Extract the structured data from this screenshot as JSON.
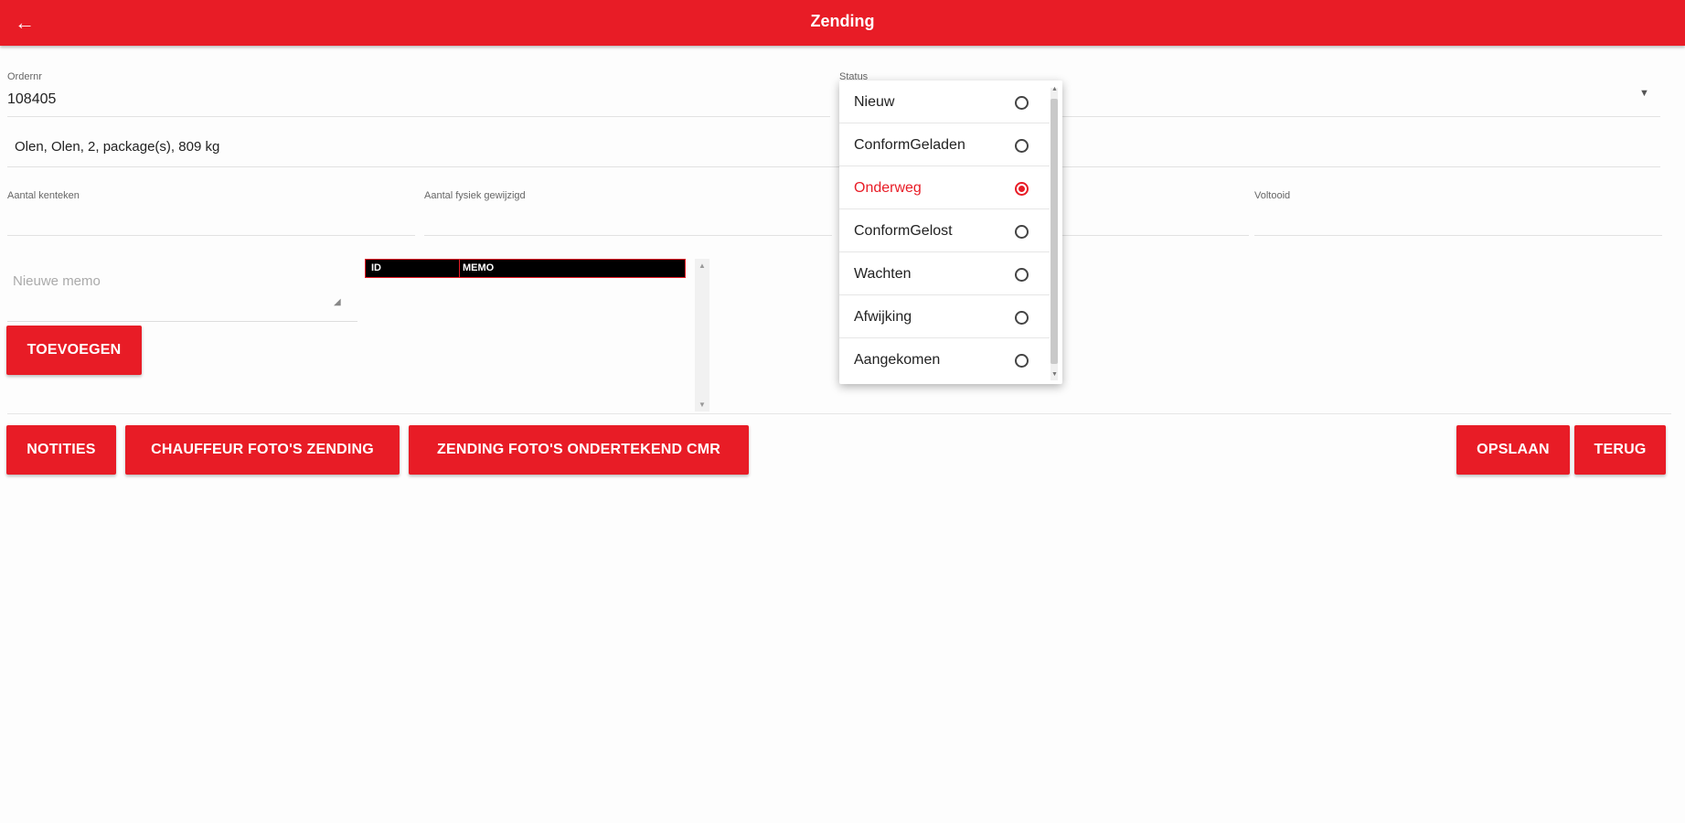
{
  "appbar": {
    "title": "Zending",
    "back_icon": "←"
  },
  "fields": {
    "ordernr": {
      "label": "Ordernr",
      "value": "108405"
    },
    "summary": {
      "value": "Olen, Olen, 2, package(s), 809 kg"
    },
    "status": {
      "label": "Status"
    },
    "aantal": {
      "label": "Aantal kenteken"
    },
    "aantal_gewijzigd": {
      "label": "Aantal fysiek gewijzigd"
    },
    "voltooid": {
      "label": "Voltooid"
    }
  },
  "memo": {
    "placeholder": "Nieuwe memo",
    "resize_icon": "◢"
  },
  "memo_table": {
    "col_id": "ID",
    "col_memo": "MEMO"
  },
  "buttons": {
    "toevoegen": "TOEVOEGEN",
    "notities": "NOTITIES",
    "chauffeur": "CHAUFFEUR FOTO'S ZENDING",
    "cmr": "ZENDING FOTO'S ONDERTEKEND CMR",
    "opslaan": "OPSLAAN",
    "terug": "TERUG"
  },
  "status_options": [
    {
      "label": "Nieuw",
      "selected": false
    },
    {
      "label": "ConformGeladen",
      "selected": false
    },
    {
      "label": "Onderweg",
      "selected": true
    },
    {
      "label": "ConformGelost",
      "selected": false
    },
    {
      "label": "Wachten",
      "selected": false
    },
    {
      "label": "Afwijking",
      "selected": false
    },
    {
      "label": "Aangekomen",
      "selected": false
    }
  ],
  "colors": {
    "accent": "#e81c26"
  }
}
